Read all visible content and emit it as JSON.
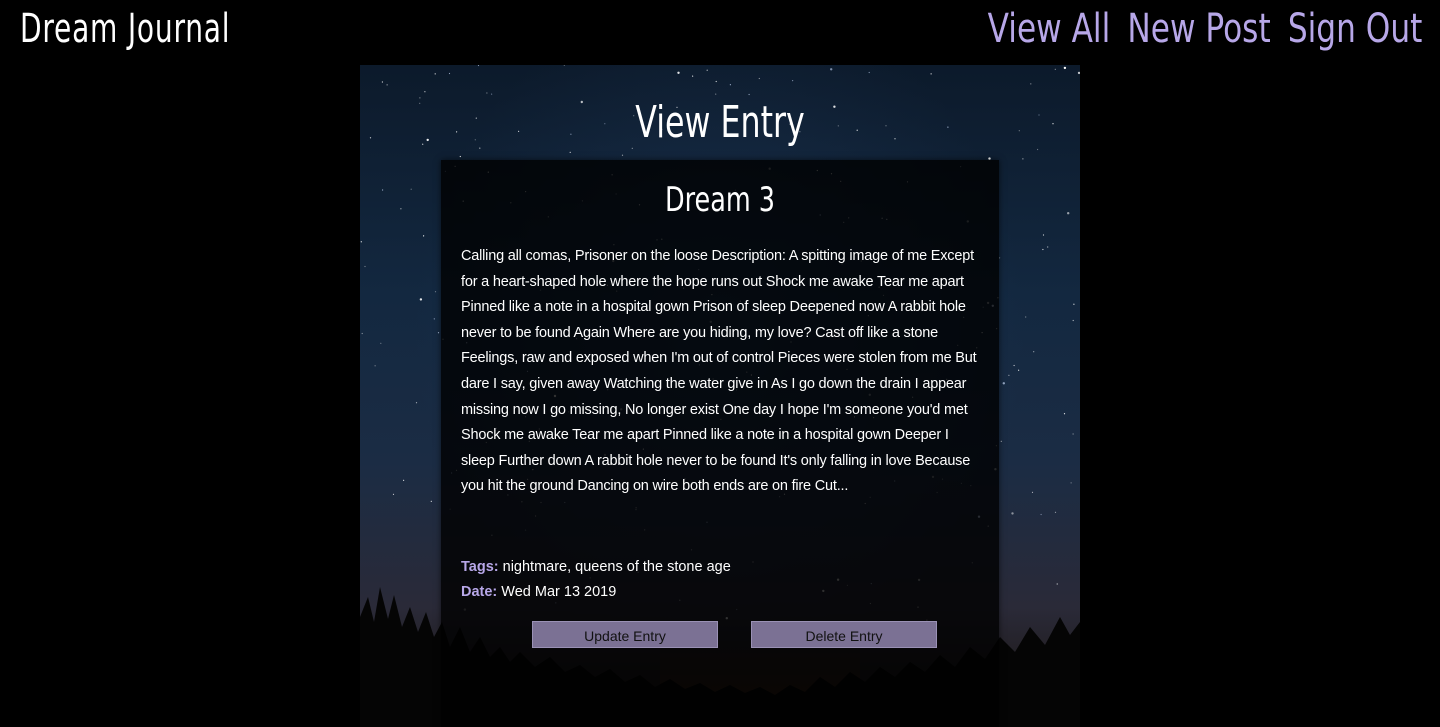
{
  "header": {
    "brand": "Dream Journal",
    "nav": [
      {
        "label": "View All"
      },
      {
        "label": "New Post"
      },
      {
        "label": "Sign Out"
      }
    ]
  },
  "main": {
    "page_title": "View Entry",
    "entry": {
      "title": "Dream 3",
      "body": "Calling all comas, Prisoner on the loose Description: A spitting image of me Except for a heart-shaped hole where the hope runs out Shock me awake Tear me apart Pinned like a note in a hospital gown Prison of sleep Deepened now A rabbit hole never to be found Again Where are you hiding, my love? Cast off like a stone Feelings, raw and exposed when I'm out of control Pieces were stolen from me But dare I say, given away Watching the water give in As I go down the drain I appear missing now I go missing, No longer exist One day I hope I'm someone you'd met Shock me awake Tear me apart Pinned like a note in a hospital gown Deeper I sleep Further down A rabbit hole never to be found It's only falling in love Because you hit the ground Dancing on wire both ends are on fire Cut...",
      "date_label": "Date:",
      "date_value": "Wed Mar 13 2019",
      "tags_label": "Tags:",
      "tags_value": "nightmare, queens of the stone age"
    },
    "buttons": {
      "update": "Update Entry",
      "delete": "Delete Entry"
    }
  },
  "colors": {
    "background": "#000000",
    "accent": "#b7a7e8",
    "button": "#7b7194"
  }
}
